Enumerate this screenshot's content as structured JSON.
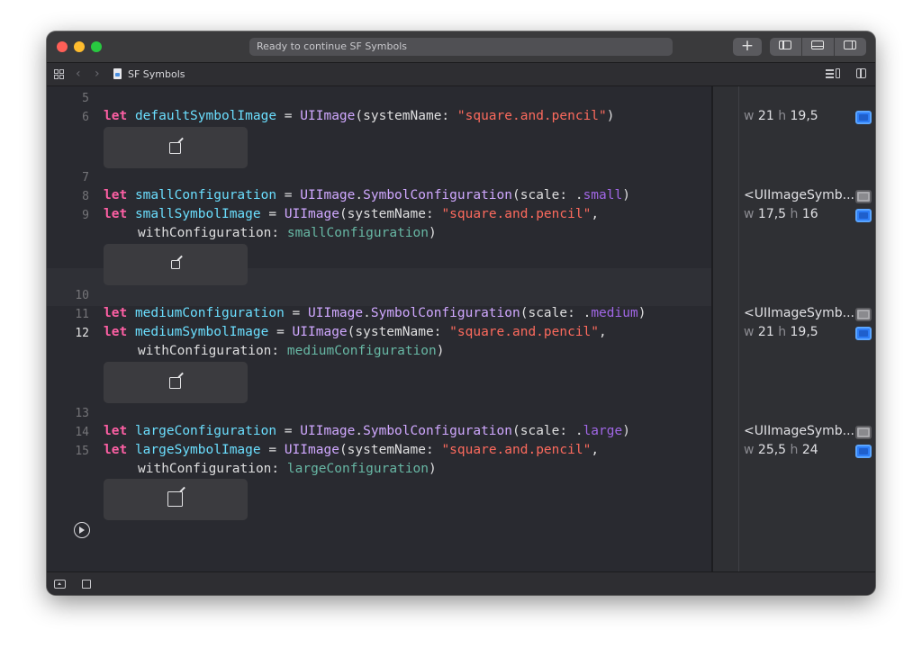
{
  "window": {
    "status_text": "Ready to continue SF Symbols",
    "toolbar": {
      "add_label": "+"
    }
  },
  "jumpbar": {
    "back_glyph": "‹",
    "forward_glyph": "›",
    "file_icon": "swift-playground-file-icon",
    "breadcrumb": "SF Symbols"
  },
  "editor": {
    "line_numbers": [
      "5",
      "6",
      "7",
      "8",
      "9",
      "10",
      "11",
      "12",
      "13",
      "14",
      "15"
    ],
    "current_line": "12",
    "lines": {
      "l6": {
        "kw": "let",
        "name": "defaultSymbolImage",
        "eq": " = ",
        "type": "UIImage",
        "p1": "(systemName: ",
        "str": "\"square.and.pencil\"",
        "p2": ")"
      },
      "l8": {
        "kw": "let",
        "name": "smallConfiguration",
        "eq": " = ",
        "type": "UIImage",
        "dot": ".",
        "type2": "SymbolConfiguration",
        "p1": "(scale: .",
        "member": "small",
        "p2": ")"
      },
      "l9": {
        "kw": "let",
        "name": "smallSymbolImage",
        "eq": " = ",
        "type": "UIImage",
        "p1": "(systemName: ",
        "str": "\"square.and.pencil\"",
        "p2": ",",
        "cont": "withConfiguration: ",
        "ref": "smallConfiguration",
        "p3": ")"
      },
      "l11": {
        "kw": "let",
        "name": "mediumConfiguration",
        "eq": " = ",
        "type": "UIImage",
        "dot": ".",
        "type2": "SymbolConfiguration",
        "p1": "(scale: .",
        "member": "medium",
        "p2": ")"
      },
      "l12": {
        "kw": "let",
        "name": "mediumSymbolImage",
        "eq": " = ",
        "type": "UIImage",
        "p1": "(systemName: ",
        "str": "\"square.and.pencil\"",
        "p2": ",",
        "cont": "withConfiguration: ",
        "ref": "mediumConfiguration",
        "p3": ")"
      },
      "l14": {
        "kw": "let",
        "name": "largeConfiguration",
        "eq": " = ",
        "type": "UIImage",
        "dot": ".",
        "type2": "SymbolConfiguration",
        "p1": "(scale: .",
        "member": "large",
        "p2": ")"
      },
      "l15": {
        "kw": "let",
        "name": "largeSymbolImage",
        "eq": " = ",
        "type": "UIImage",
        "p1": "(systemName: ",
        "str": "\"square.and.pencil\"",
        "p2": ",",
        "cont": "withConfiguration: ",
        "ref": "largeConfiguration",
        "p3": ")"
      }
    },
    "previews": [
      {
        "icon": "square-and-pencil-icon"
      },
      {
        "icon": "square-and-pencil-icon"
      },
      {
        "icon": "square-and-pencil-icon"
      },
      {
        "icon": "square-and-pencil-icon"
      }
    ]
  },
  "results": {
    "r6": {
      "w_label": "w",
      "w": "21",
      "h_label": "h",
      "h": "19,5"
    },
    "r8": {
      "text": "<UIImageSymb..."
    },
    "r9": {
      "w_label": "w",
      "w": "17,5",
      "h_label": "h",
      "h": "16"
    },
    "r11": {
      "text": "<UIImageSymb..."
    },
    "r12": {
      "w_label": "w",
      "w": "21",
      "h_label": "h",
      "h": "19,5"
    },
    "r14": {
      "text": "<UIImageSymb..."
    },
    "r15": {
      "w_label": "w",
      "w": "25,5",
      "h_label": "h",
      "h": "24"
    }
  },
  "colors": {
    "keyword": "#fc5fa3",
    "variable": "#6bdfff",
    "type": "#d0a8ff",
    "string": "#fc6a5d",
    "reference": "#67b7a4",
    "member": "#a167e6",
    "quicklook_active": "#2d7df6"
  }
}
